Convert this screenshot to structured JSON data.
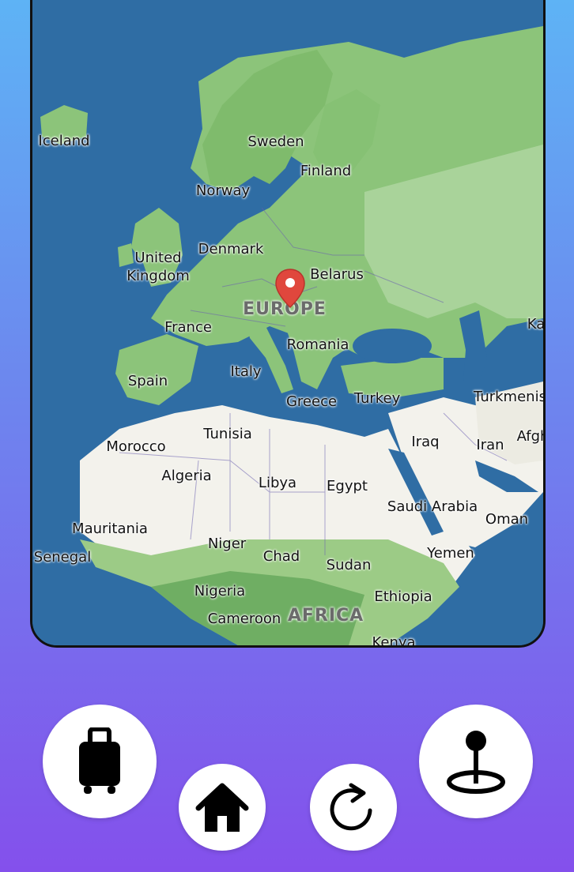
{
  "map": {
    "regions": {
      "europe": "EUROPE",
      "africa": "AFRICA"
    },
    "labels": {
      "iceland": "Iceland",
      "sweden": "Sweden",
      "finland": "Finland",
      "norway": "Norway",
      "denmark": "Denmark",
      "united_kingdom_1": "United",
      "united_kingdom_2": "Kingdom",
      "belarus": "Belarus",
      "france": "France",
      "romania": "Romania",
      "ka": "Ka",
      "italy": "Italy",
      "spain": "Spain",
      "greece": "Greece",
      "turkey": "Turkey",
      "turkmenis": "Turkmenis",
      "tunisia": "Tunisia",
      "morocco": "Morocco",
      "iraq": "Iraq",
      "iran": "Iran",
      "afgh": "Afgh",
      "algeria": "Algeria",
      "libya": "Libya",
      "egypt": "Egypt",
      "saudi_arabia": "Saudi Arabia",
      "oman": "Oman",
      "mauritania": "Mauritania",
      "niger": "Niger",
      "chad": "Chad",
      "senegal": "Senegal",
      "sudan": "Sudan",
      "yemen": "Yemen",
      "nigeria": "Nigeria",
      "ethiopia": "Ethiopia",
      "cameroon": "Cameroon",
      "kenya": "Kenya"
    },
    "marker": {
      "icon": "map-pin-icon",
      "color": "#e0473d"
    },
    "colors": {
      "sea": "#2f6da4",
      "land": "#8cc47a",
      "forest": "#6fae63",
      "desert": "#f4f3ee"
    }
  },
  "toolbar": {
    "luggage_icon": "luggage-icon",
    "home_icon": "home-icon",
    "refresh_icon": "refresh-icon",
    "location_icon": "location-pin-icon"
  }
}
